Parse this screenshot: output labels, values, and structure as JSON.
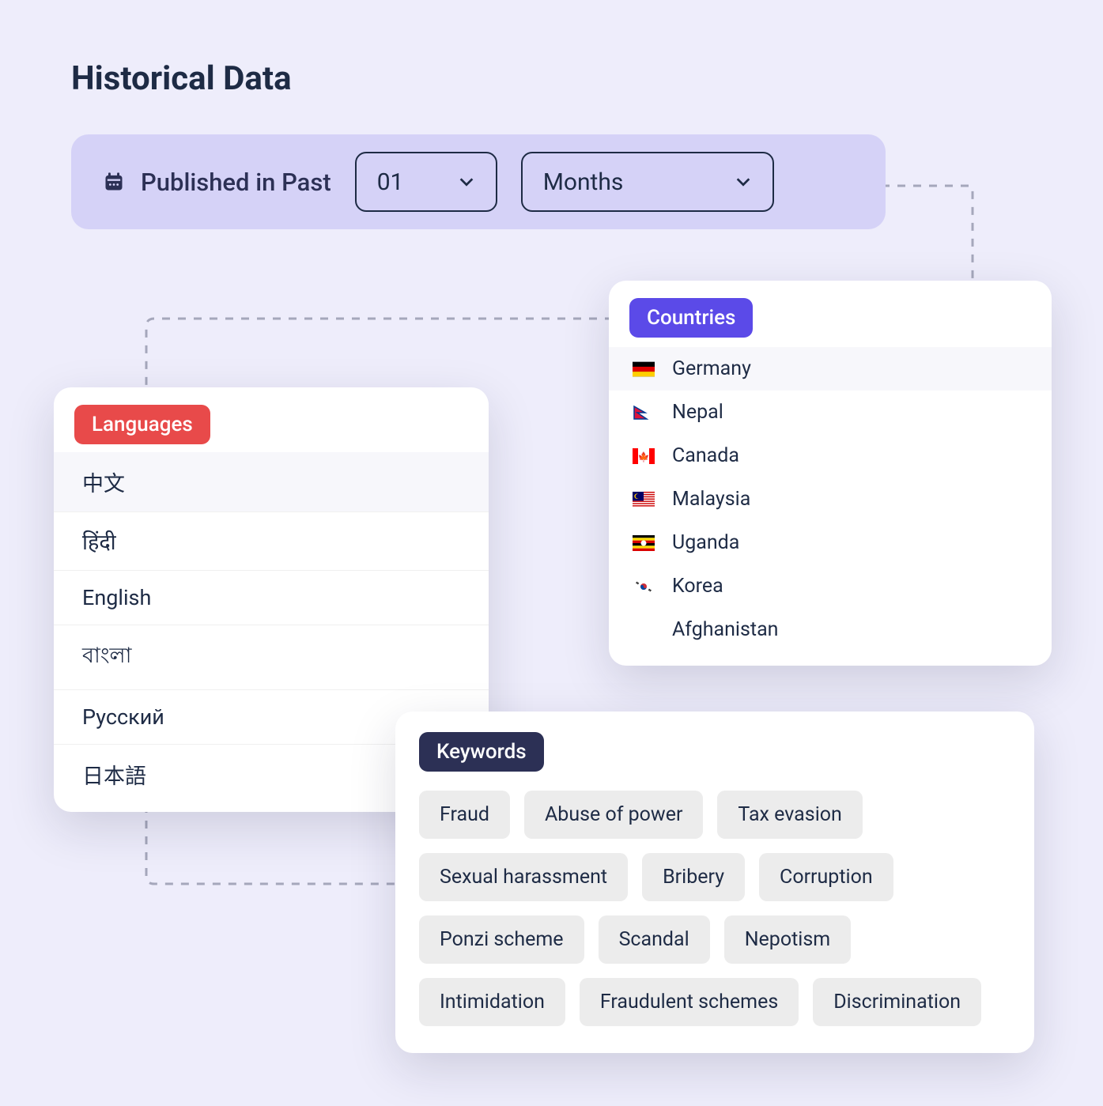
{
  "title": "Historical Data",
  "filter": {
    "label": "Published in Past",
    "number": "01",
    "unit": "Months"
  },
  "languages": {
    "pill": "Languages",
    "items": [
      "中文",
      "हिंदी",
      "English",
      "বাংলা",
      "Русский",
      "日本語"
    ]
  },
  "countries": {
    "pill": "Countries",
    "items": [
      {
        "flag": "germany",
        "name": "Germany"
      },
      {
        "flag": "nepal",
        "name": "Nepal"
      },
      {
        "flag": "canada",
        "name": "Canada"
      },
      {
        "flag": "malaysia",
        "name": "Malaysia"
      },
      {
        "flag": "uganda",
        "name": "Uganda"
      },
      {
        "flag": "korea",
        "name": "Korea"
      },
      {
        "flag": "afghanistan",
        "name": "Afghanistan"
      }
    ]
  },
  "keywords": {
    "pill": "Keywords",
    "items": [
      "Fraud",
      "Abuse of power",
      "Tax evasion",
      "Sexual harassment",
      "Bribery",
      "Corruption",
      "Ponzi scheme",
      "Scandal",
      "Nepotism",
      "Intimidation",
      "Fraudulent schemes",
      "Discrimination"
    ]
  }
}
